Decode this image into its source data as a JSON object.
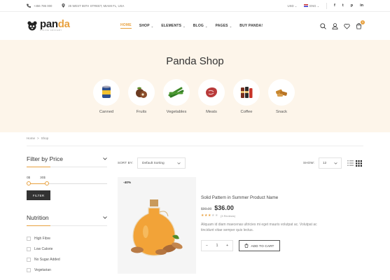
{
  "topbar": {
    "phone": "+456 786 000",
    "address": "25 WEST 55TH STREET, MIAMI FL, USA",
    "currency": "USD",
    "language": "ENG",
    "social": [
      "f",
      "t",
      "p",
      "in"
    ]
  },
  "header": {
    "logo_main": "pan",
    "logo_accent": "da",
    "logo_tagline": "ONLINE GROCERY",
    "nav": [
      {
        "label": "HOME",
        "active": true,
        "dropdown": false
      },
      {
        "label": "SHOP",
        "dropdown": true
      },
      {
        "label": "ELEMENTS",
        "dropdown": true
      },
      {
        "label": "BLOG",
        "dropdown": true
      },
      {
        "label": "PAGES",
        "dropdown": true
      },
      {
        "label": "BUY PANDA!",
        "dropdown": false
      }
    ],
    "cart_count": "0",
    "icons": [
      "search-icon",
      "user-icon",
      "heart-icon",
      "cart-icon"
    ]
  },
  "banner": {
    "title": "Panda Shop",
    "categories": [
      {
        "label": "Canned"
      },
      {
        "label": "Fruits"
      },
      {
        "label": "Vegetables"
      },
      {
        "label": "Meats"
      },
      {
        "label": "Coffee"
      },
      {
        "label": "Snack"
      }
    ]
  },
  "breadcrumb": {
    "home": "Home",
    "separator": ">",
    "current": "Shop"
  },
  "sidebar": {
    "price_title": "Filter by Price",
    "price_min": "0$",
    "price_max": "30$",
    "filter_button": "FILTER",
    "nutrition_title": "Nutrition",
    "nutrition_options": [
      "High Fibre",
      "Low Calorie",
      "No Sugar Added",
      "Vegetarian"
    ]
  },
  "toolbar": {
    "sort_label": "SORT BY:",
    "sort_value": "Default Sorting",
    "show_label": "SHOW:",
    "show_value": "12"
  },
  "product": {
    "badge": "-40%",
    "title": "Solid Pattern in Summer Product Name",
    "old_price": "$90.00",
    "new_price": "$36.00",
    "rating": 3,
    "rating_max": 5,
    "reviews": "(3 Reviews)",
    "description": "Aliquam id diam maecenas ultricies mi eget mauris volutpat ac. Volutpat ac tincidunt vitae semper quis lectus.",
    "qty": "1",
    "qty_minus": "−",
    "qty_plus": "+",
    "add_to_cart": "ADD TO CART"
  },
  "colors": {
    "accent": "#e8a13f",
    "banner_bg": "#fdf5ea",
    "dark": "#333333"
  }
}
